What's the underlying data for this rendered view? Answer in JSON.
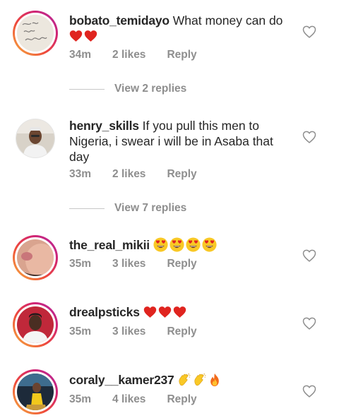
{
  "comments": [
    {
      "username": "bobato_temidayo",
      "text": "What money can do",
      "emoji_count": 2,
      "time": "34m",
      "likes": "2 likes",
      "reply": "Reply",
      "view_replies": "View 2 replies",
      "avatar_ring": "story"
    },
    {
      "username": "henry_skills",
      "text": "If you pull this men to Nigeria,  i swear i will be in Asaba that day",
      "time": "33m",
      "likes": "2 likes",
      "reply": "Reply",
      "view_replies": "View 7 replies",
      "avatar_ring": "none"
    },
    {
      "username": "the_real_mikii",
      "text": "",
      "emoji_count": 4,
      "time": "35m",
      "likes": "3 likes",
      "reply": "Reply",
      "avatar_ring": "story"
    },
    {
      "username": "drealpsticks",
      "text": "",
      "emoji_count": 3,
      "time": "35m",
      "likes": "3 likes",
      "reply": "Reply",
      "avatar_ring": "story"
    },
    {
      "username": "coraly__kamer237",
      "text": "",
      "time": "35m",
      "likes": "4 likes",
      "reply": "Reply",
      "avatar_ring": "story"
    }
  ],
  "icons": {
    "like": "heart-outline-icon",
    "emoji_heart": "red-heart",
    "emoji_face": "heart-eyes-face",
    "emoji_clap": "clapping-hands",
    "emoji_fire": "fire"
  },
  "colors": {
    "text": "#262626",
    "meta": "#8e8e8e",
    "heart_red": "#e0241f",
    "emoji_yellow": "#f9c826"
  }
}
